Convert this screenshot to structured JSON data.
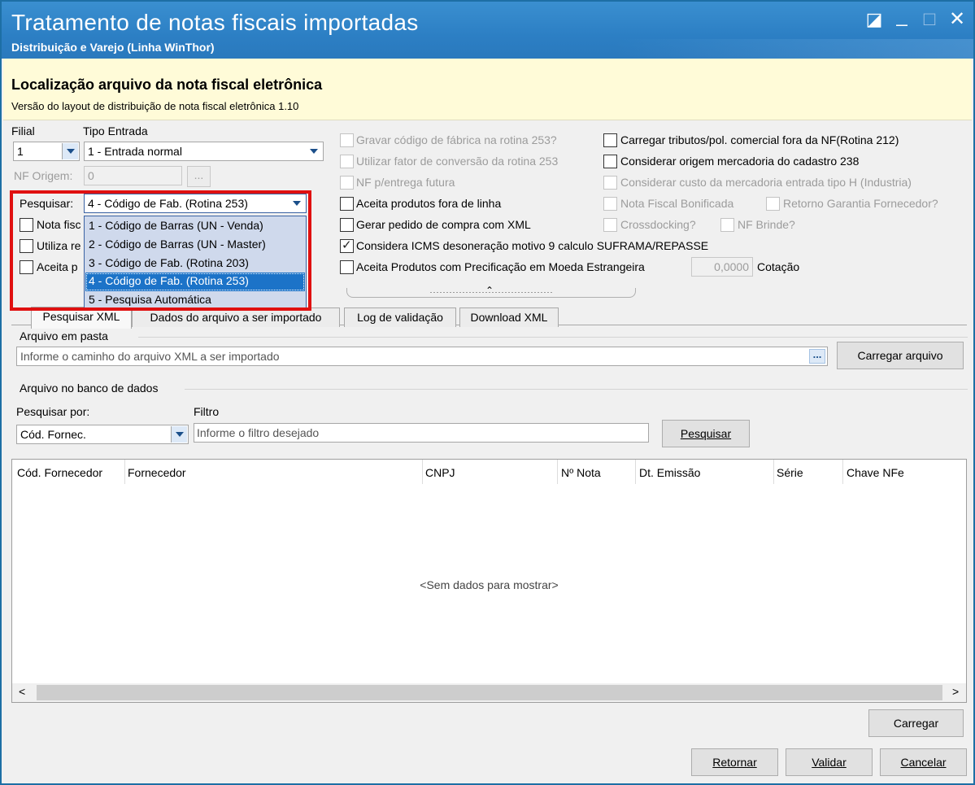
{
  "window": {
    "title": "Tratamento de notas fiscais importadas",
    "subtitle": "Distribuição e Varejo (Linha WinThor)",
    "controls": {
      "restore": "◪",
      "minimize": "_",
      "maximize": "□",
      "close": "✕"
    }
  },
  "header": {
    "title": "Localização arquivo da nota fiscal eletrônica",
    "description": "Versão do layout de distribuição de nota fiscal eletrônica 1.10"
  },
  "form": {
    "filial_label": "Filial",
    "filial_value": "1",
    "tipo_entrada_label": "Tipo Entrada",
    "tipo_entrada_value": "1 - Entrada normal",
    "nf_origem_label": "NF Origem:",
    "nf_origem_value": "0",
    "nf_origem_btn": "...",
    "pesquisar_label": "Pesquisar:",
    "pesquisar_value": "4 - Código de Fab. (Rotina 253)",
    "dropdown_options": [
      "1 - Código de Barras (UN - Venda)",
      "2 - Código de Barras (UN - Master)",
      "3 - Código de Fab. (Rotina 203)",
      "4 - Código de Fab. (Rotina 253)",
      "5 - Pesquisa Automática"
    ],
    "left_checks": [
      "Nota fisc",
      "Utiliza re",
      "Aceita p"
    ]
  },
  "checks_mid": [
    {
      "label": "Gravar código de fábrica na rotina 253?",
      "enabled": false,
      "checked": false
    },
    {
      "label": "Utilizar fator de conversão da rotina 253",
      "enabled": false,
      "checked": false
    },
    {
      "label": "NF p/entrega futura",
      "enabled": false,
      "checked": false
    },
    {
      "label": "Aceita produtos fora de linha",
      "enabled": true,
      "checked": false
    },
    {
      "label": "Gerar pedido de compra com XML",
      "enabled": true,
      "checked": false
    },
    {
      "label": "Considera ICMS desoneração motivo 9 calculo SUFRAMA/REPASSE",
      "enabled": true,
      "checked": true
    },
    {
      "label": "Aceita Produtos com Precificação em Moeda Estrangeira",
      "enabled": true,
      "checked": false
    }
  ],
  "checks_right": [
    {
      "label": "Carregar tributos/pol. comercial fora da NF(Rotina 212)",
      "enabled": true
    },
    {
      "label": "Considerar origem mercadoria do cadastro 238",
      "enabled": true
    },
    {
      "label": "Considerar custo da mercadoria entrada tipo H (Industria)",
      "enabled": false
    },
    {
      "label": "Nota Fiscal Bonificada",
      "enabled": false
    },
    {
      "label": "Retorno Garantia Fornecedor?",
      "enabled": false
    },
    {
      "label": "Crossdocking?",
      "enabled": false
    },
    {
      "label": "NF Brinde?",
      "enabled": false
    }
  ],
  "cotacao": {
    "value": "0,0000",
    "label": "Cotação"
  },
  "tabs": [
    "Pesquisar XML",
    "Dados do arquivo a ser importado",
    "Log de validação",
    "Download XML"
  ],
  "arquivo_pasta": {
    "group_label": "Arquivo em pasta",
    "placeholder": "Informe o caminho do arquivo XML a ser importado",
    "browse": "...",
    "load_button": "Carregar arquivo"
  },
  "banco_dados": {
    "group_label": "Arquivo no banco de dados",
    "search_by_label": "Pesquisar por:",
    "search_by_value": "Cód. Fornec.",
    "filter_label": "Filtro",
    "filter_placeholder": "Informe o filtro desejado",
    "search_button": "Pesquisar"
  },
  "grid": {
    "columns": [
      "Cód. Fornecedor",
      "Fornecedor",
      "CNPJ",
      "Nº Nota",
      "Dt. Emissão",
      "Série",
      "Chave NFe"
    ],
    "empty_text": "<Sem dados para mostrar>",
    "scroll_left": "<",
    "scroll_right": ">"
  },
  "buttons": {
    "carregar": "Carregar",
    "retornar": "Retornar",
    "validar": "Validar",
    "cancelar": "Cancelar"
  },
  "colors": {
    "titlebar": "#2c7fc4",
    "header_band": "#fffbd8",
    "highlight": "#e01010",
    "selection": "#1c73c8"
  }
}
